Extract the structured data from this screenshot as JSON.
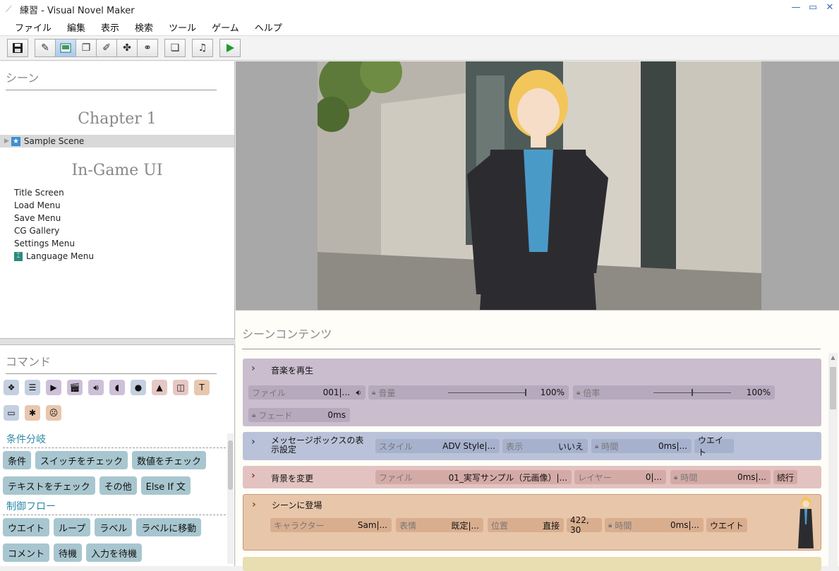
{
  "window": {
    "title": "練習 - Visual Novel Maker"
  },
  "menu": [
    "ファイル",
    "編集",
    "表示",
    "検索",
    "ツール",
    "ゲーム",
    "ヘルプ"
  ],
  "scene_panel": {
    "header": "シーン",
    "chapter": "Chapter 1",
    "scene": "Sample Scene",
    "ui_title": "In-Game UI",
    "ui_items": [
      "Title Screen",
      "Load Menu",
      "Save Menu",
      "CG Gallery",
      "Settings Menu",
      "Language Menu"
    ]
  },
  "command_panel": {
    "header": "コマンド",
    "icons": [
      "cube-icon",
      "list-icon",
      "video-icon",
      "clapper-icon",
      "speaker-icon",
      "voice-icon",
      "speech-bubble-icon",
      "image-icon",
      "frame-icon",
      "text-icon",
      "screen-icon",
      "gear-icon",
      "face-icon"
    ],
    "section_conditions": "条件分岐",
    "condition_buttons": [
      "条件",
      "スイッチをチェック",
      "数値をチェック",
      "テキストをチェック",
      "その他",
      "Else If 文"
    ],
    "section_flow": "制御フロー",
    "flow_buttons": [
      "ウエイト",
      "ループ",
      "ラベル",
      "ラベルに移動",
      "コメント",
      "待機",
      "入力を待機"
    ]
  },
  "contents": {
    "header": "シーンコンテンツ",
    "music": {
      "title": "音楽を再生",
      "file_label": "ファイル",
      "file_value": "001|...",
      "volume_label": "音量",
      "volume_value": "100%",
      "rate_label": "倍率",
      "rate_value": "100%",
      "fade_label": "フェード",
      "fade_value": "0ms"
    },
    "msgbox": {
      "title": "メッセージボックスの表示設定",
      "style_label": "スタイル",
      "style_value": "ADV Style|...",
      "visible_label": "表示",
      "visible_value": "いいえ",
      "time_label": "時間",
      "time_value": "0ms|...",
      "wait_label": "ウエイト"
    },
    "background": {
      "title": "背景を変更",
      "file_label": "ファイル",
      "file_value": "01_実写サンプル（元画像）|...",
      "layer_label": "レイヤー",
      "layer_value": "0|...",
      "time_label": "時間",
      "time_value": "0ms|...",
      "next_label": "続行"
    },
    "show_char": {
      "title": "シーンに登場",
      "char_label": "キャラクター",
      "char_value": "Sam|...",
      "expr_label": "表情",
      "expr_value": "既定|...",
      "pos_label": "位置",
      "pos_value": "直接",
      "coords": "422, 30",
      "time_label": "時間",
      "time_value": "0ms|...",
      "wait_label": "ウエイト"
    },
    "next_card": {
      "title": "",
      "field": ""
    }
  }
}
